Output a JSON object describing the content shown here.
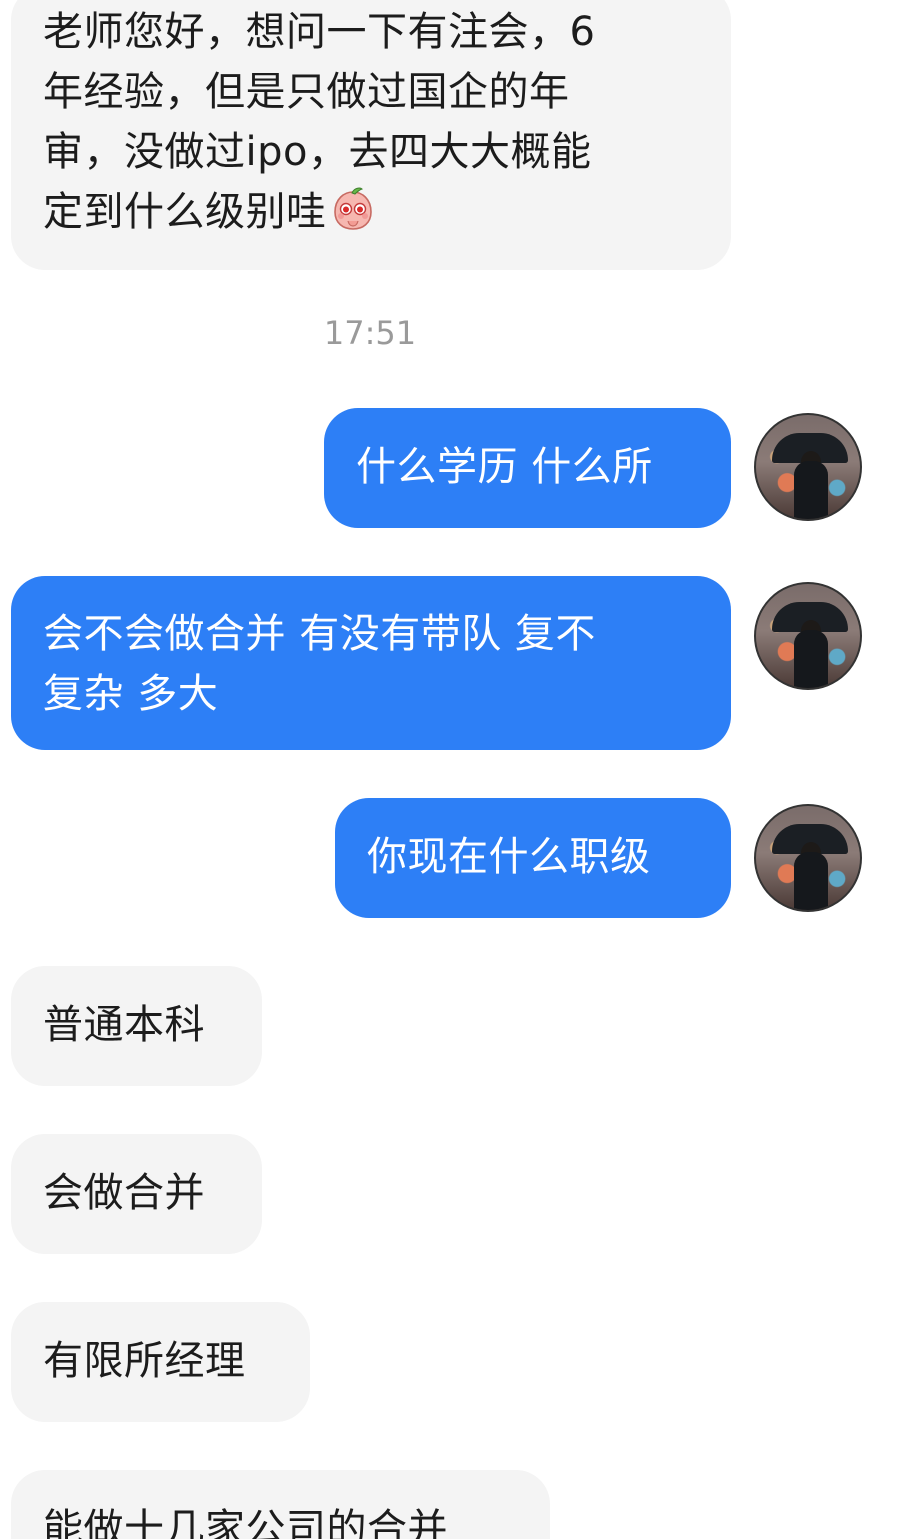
{
  "messages": {
    "m1": {
      "lines": [
        "老师您好，想问一下有注会，6",
        "年经验，但是只做过国企的年",
        "审，没做过ipo，去四大大概能",
        "定到什么级别哇"
      ],
      "emoji_icon": "pleading-peach-emoji-icon"
    },
    "timestamp": "17:51",
    "m2": {
      "text": "什么学历 什么所"
    },
    "m3": {
      "lines": [
        "会不会做合并 有没有带队 复不",
        "复杂 多大"
      ]
    },
    "m4": {
      "text": "你现在什么职级"
    },
    "m5": {
      "text": "普通本科"
    },
    "m6": {
      "text": "会做合并"
    },
    "m7": {
      "text": "有限所经理"
    },
    "m8": {
      "text": "能做十几家公司的合并"
    }
  },
  "avatar_icon": "man-with-umbrella-avatar",
  "colors": {
    "incoming_bubble": "#f4f4f4",
    "outgoing_bubble": "#2d7ff6",
    "timestamp_text": "#9a9a9a"
  }
}
